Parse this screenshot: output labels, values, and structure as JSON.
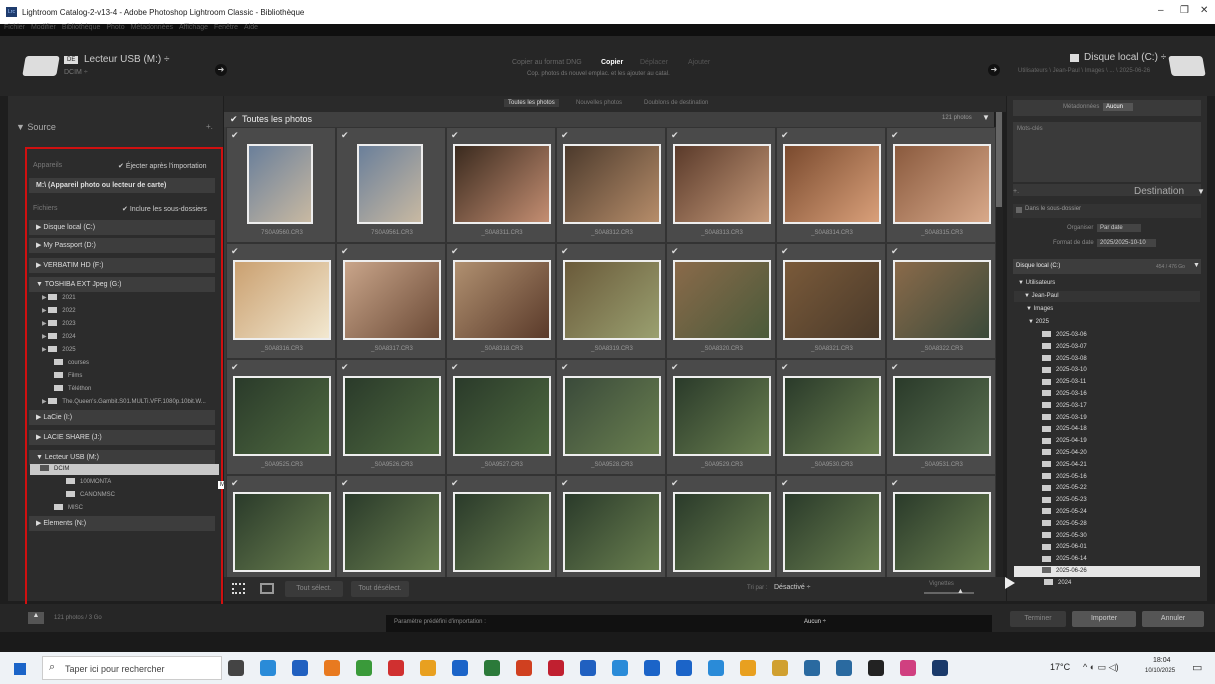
{
  "window": {
    "title": "Lightroom Catalog-2-v13-4 - Adobe Photoshop Lightroom Classic - Bibliothèque",
    "logo": "Lrc",
    "min": "–",
    "max": "❐",
    "close": "✕"
  },
  "menu": [
    "Fichier",
    "Modifier",
    "Bibliothèque",
    "Photo",
    "Métadonnées",
    "Affichage",
    "Fenêtre",
    "Aide"
  ],
  "top": {
    "source_badge": "DE",
    "source_name": "Lecteur USB (M:) ÷",
    "source_sub": "DCIM ÷",
    "mode_dng": "Copier au format DNG",
    "mode_copy": "Copier",
    "mode_move": "Déplacer",
    "mode_add": "Ajouter",
    "mode_desc": "Cop. photos ds nouvel emplac. et les ajouter au catal.",
    "dest_name": "Disque local (C:) ÷",
    "dest_path": "Utilisateurs \\ Jean-Paul \\ Images \\ ... \\ 2025-06-26"
  },
  "source": {
    "title": "Source",
    "plus": "+.",
    "devices_label": "Appareils",
    "eject_label": "Éjecter après l'importation",
    "device": "M:\\ (Appareil photo ou lecteur de carte)",
    "files_label": "Fichiers",
    "include_label": "Inclure les sous-dossiers",
    "drives": [
      "Disque local (C:)",
      "My Passport (D:)",
      "VERBATIM HD (F:)"
    ],
    "toshiba": "TOSHIBA EXT Jpeg (G:)",
    "toshiba_sub": [
      "2021",
      "2022",
      "2023",
      "2024",
      "2025",
      "courses",
      "Films",
      "Téléthon",
      "The.Queen's.Gambit.S01.MULTi.VFF.1080p.10bit.W..."
    ],
    "drives2": [
      "LaCie (I:)",
      "LACIE SHARE (J:)"
    ],
    "usb": "Lecteur USB (M:)",
    "usb_sub": [
      "DCIM",
      "100MONTA",
      "CANONMSC",
      "MISC"
    ],
    "elements": "Elements (N:)",
    "tooltip": "M:\\DCIM"
  },
  "grid": {
    "tabs": [
      "Toutes les photos",
      "Nouvelles photos",
      "Doublons de destination"
    ],
    "header": "Toutes les photos",
    "count": "121 photos",
    "files": [
      "7S0A9560.CR3",
      "7S0A9561.CR3",
      "_S0A8311.CR3",
      "_S0A8312.CR3",
      "_S0A8313.CR3",
      "_S0A8314.CR3",
      "_S0A8315.CR3",
      "_S0A8316.CR3",
      "_S0A8317.CR3",
      "_S0A8318.CR3",
      "_S0A8319.CR3",
      "_S0A8320.CR3",
      "_S0A8321.CR3",
      "_S0A8322.CR3",
      "_S0A9525.CR3",
      "_S0A9526.CR3",
      "_S0A9527.CR3",
      "_S0A9528.CR3",
      "_S0A9529.CR3",
      "_S0A9530.CR3",
      "_S0A9531.CR3"
    ],
    "select_all": "Tout sélect.",
    "deselect_all": "Tout désélect.",
    "sort_label": "Tri par :",
    "sort_value": "Désactivé ÷",
    "thumbs_label": "Vignettes"
  },
  "right": {
    "meta_label": "Métadonnées",
    "meta_value": "Aucun",
    "keywords": "Mots-clés",
    "dest_title": "Destination",
    "subfolder": "Dans le sous-dossier",
    "organize_label": "Organiser",
    "organize_value": "Par date",
    "date_label": "Format de date",
    "date_value": "2025/2025-10-10",
    "disk": "Disque local (C:)",
    "disk_free": "454 / 476 Go",
    "users": "Utilisateurs",
    "jp": "Jean-Paul",
    "images": "Images",
    "y2025": "2025",
    "dates": [
      "2025-03-06",
      "2025-03-07",
      "2025-03-08",
      "2025-03-10",
      "2025-03-11",
      "2025-03-16",
      "2025-03-17",
      "2025-03-19",
      "2025-04-18",
      "2025-04-19",
      "2025-04-20",
      "2025-04-21",
      "2025-05-16",
      "2025-05-22",
      "2025-05-23",
      "2025-05-24",
      "2025-05-28",
      "2025-05-30",
      "2025-06-01",
      "2025-06-14",
      "2025-06-26",
      "2024"
    ]
  },
  "bottom": {
    "info": "121 photos / 3 Go",
    "preset_label": "Paramètre prédéfini d'importation :",
    "preset_value": "Aucun ÷",
    "done": "Terminer",
    "import": "Importer",
    "cancel": "Annuler"
  },
  "taskbar": {
    "search": "Taper ici pour rechercher",
    "weather": "17°C",
    "time": "18:04",
    "date": "10/10/2025"
  }
}
